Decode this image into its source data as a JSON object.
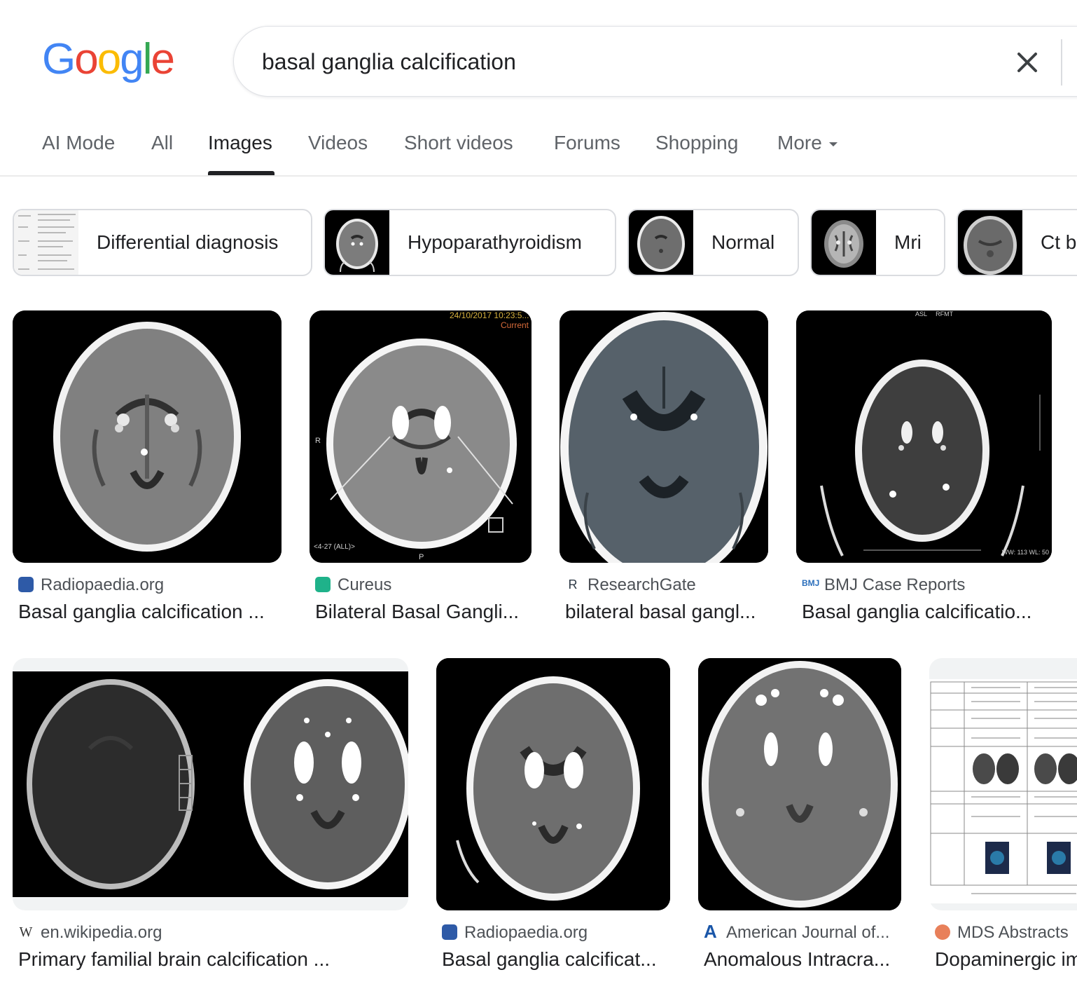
{
  "logo": {
    "letters": [
      "G",
      "o",
      "o",
      "g",
      "l",
      "e"
    ],
    "colors": [
      "#4285F4",
      "#EA4335",
      "#FBBC05",
      "#4285F4",
      "#34A853",
      "#EA4335"
    ]
  },
  "search": {
    "query": "basal ganglia calcification",
    "clear_icon": "close-icon"
  },
  "tabs": [
    "AI Mode",
    "All",
    "Images",
    "Videos",
    "Short videos",
    "Forums",
    "Shopping",
    "More"
  ],
  "active_tab": "Images",
  "chips": [
    "Differential diagnosis",
    "Hypoparathyroidism",
    "Normal",
    "Mri",
    "Ct b"
  ],
  "results": [
    {
      "source": "Radiopaedia.org",
      "title": "Basal ganglia calcification ...",
      "icon": "radiopaedia-icon"
    },
    {
      "source": "Cureus",
      "title": "Bilateral Basal Gangli...",
      "icon": "cureus-icon"
    },
    {
      "source": "ResearchGate",
      "title": "bilateral basal gangl...",
      "icon": "researchgate-icon"
    },
    {
      "source": "BMJ Case Reports",
      "title": "Basal ganglia calcificatio...",
      "icon": "bmj-icon"
    },
    {
      "source": "en.wikipedia.org",
      "title": "Primary familial brain calcification ...",
      "icon": "wikipedia-icon"
    },
    {
      "source": "Radiopaedia.org",
      "title": "Basal ganglia calcificat...",
      "icon": "radiopaedia-icon"
    },
    {
      "source": "American Journal of...",
      "title": "Anomalous Intracra...",
      "icon": "ajnr-icon"
    },
    {
      "source": "MDS Abstracts",
      "title": "Dopaminergic im",
      "icon": "mds-icon"
    }
  ],
  "image_text": {
    "r2_stamp": "24/10/2017 10:23:5...",
    "r2_current": "Current",
    "r2_footer": "<4-27 (ALL)>",
    "r2_side_r": "R",
    "r2_side_p": "P",
    "r4_top": "ASL     RFMT",
    "r4_bottom": "WW: 113 WL: 50"
  },
  "accent_colors": {
    "tab_underline": "#202124",
    "text_secondary": "#5f6368",
    "cureus": "#1fb28a",
    "bmj": "#2a6ebb",
    "ajnr": "#1a56a8",
    "mds": "#e8805a"
  }
}
